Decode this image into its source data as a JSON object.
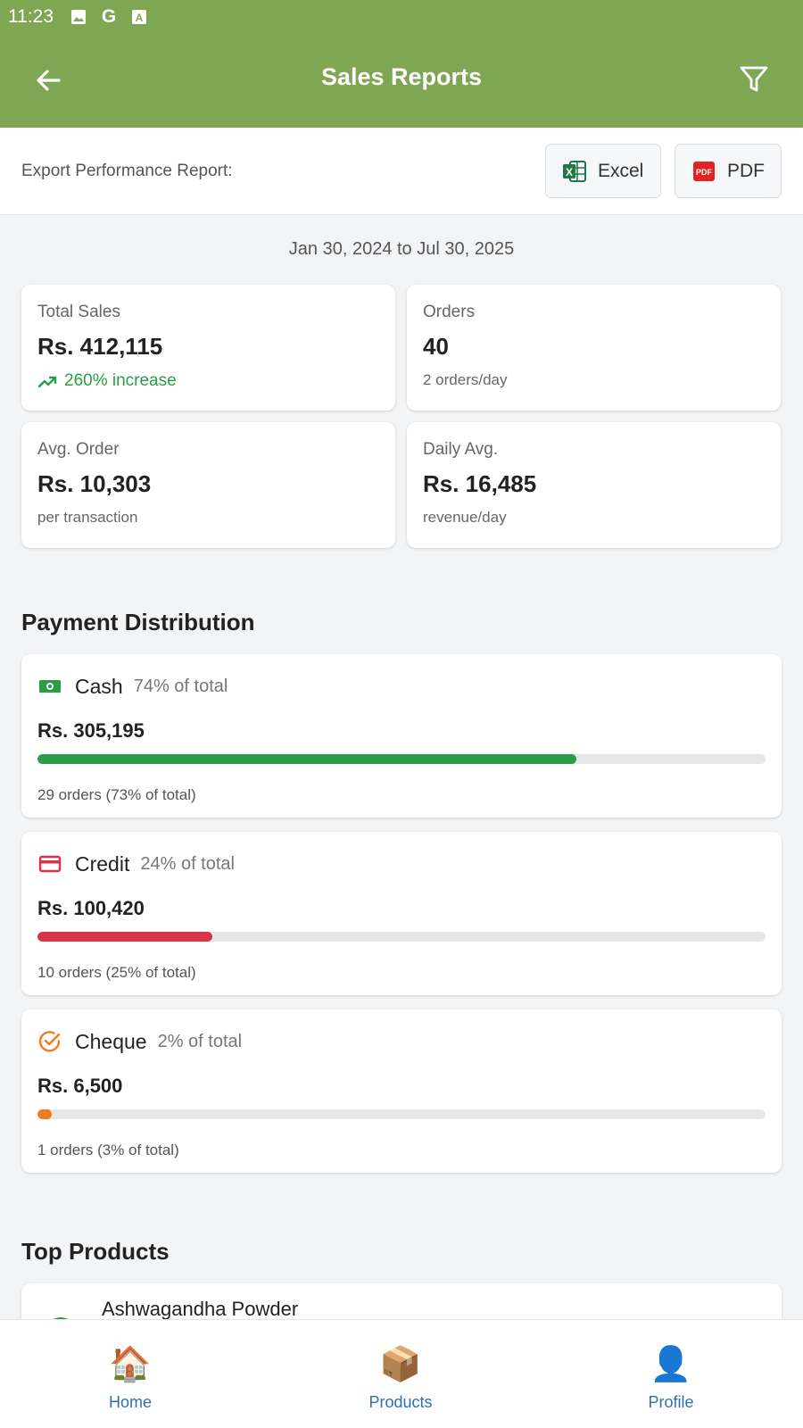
{
  "status_bar": {
    "time": "11:23",
    "icons": [
      "image-icon",
      "google-icon",
      "font-icon"
    ]
  },
  "app_bar": {
    "title": "Sales Reports",
    "back_icon": "arrow-left-icon",
    "filter_icon": "filter-icon",
    "background": "#7fa653"
  },
  "export": {
    "label": "Export Performance Report:",
    "excel_label": "Excel",
    "pdf_label": "PDF"
  },
  "date_range": "Jan 30, 2024 to Jul 30, 2025",
  "stats": {
    "total_sales": {
      "label": "Total Sales",
      "value": "Rs. 412,115",
      "sub": "260% increase"
    },
    "orders": {
      "label": "Orders",
      "value": "40",
      "sub": "2 orders/day"
    },
    "avg_order": {
      "label": "Avg. Order",
      "value": "Rs. 10,303",
      "sub": "per transaction"
    },
    "daily_avg": {
      "label": "Daily Avg.",
      "value": "Rs. 16,485",
      "sub": "revenue/day"
    }
  },
  "payment_distribution": {
    "title": "Payment Distribution",
    "items": [
      {
        "name": "Cash",
        "pct_text": "74% of total",
        "amount": "Rs. 305,195",
        "orders_text": "29 orders (73% of total)",
        "share": 0.74,
        "color": "#2a9d46",
        "icon": "cash-icon"
      },
      {
        "name": "Credit",
        "pct_text": "24% of total",
        "amount": "Rs. 100,420",
        "orders_text": "10 orders (25% of total)",
        "share": 0.24,
        "color": "#d9334a",
        "icon": "credit-card-icon"
      },
      {
        "name": "Cheque",
        "pct_text": "2% of total",
        "amount": "Rs. 6,500",
        "orders_text": "1 orders (3% of total)",
        "share": 0.02,
        "color": "#f07c1b",
        "icon": "check-circle-icon"
      }
    ]
  },
  "top_products": {
    "title": "Top Products",
    "first_product": "Ashwagandha Powder"
  },
  "bottom_nav": {
    "home": "Home",
    "products": "Products",
    "profile": "Profile"
  }
}
